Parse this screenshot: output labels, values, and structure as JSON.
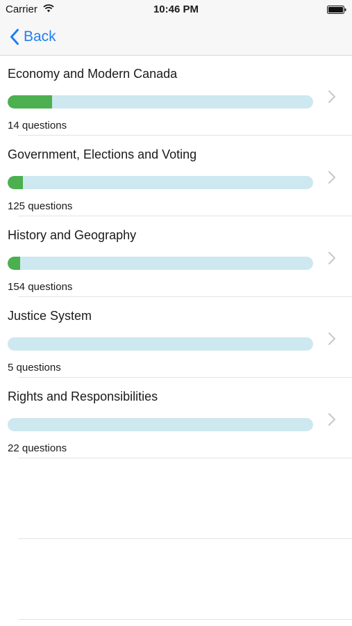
{
  "status_bar": {
    "carrier": "Carrier",
    "time": "10:46 PM",
    "wifi_icon": "wifi-icon",
    "battery_icon": "battery-icon"
  },
  "nav": {
    "back_label": "Back",
    "back_icon": "chevron-left-icon",
    "accent_color": "#1f7ef2"
  },
  "colors": {
    "progress_fill": "#4caf50",
    "progress_track": "#cde8ef",
    "disclosure_chevron": "#c7c7cc"
  },
  "categories": [
    {
      "title": "Economy and Modern Canada",
      "count_label": "14 questions",
      "progress": 0.145,
      "chevron_icon": "chevron-right-icon"
    },
    {
      "title": "Government, Elections and Voting",
      "count_label": "125 questions",
      "progress": 0.05,
      "chevron_icon": "chevron-right-icon"
    },
    {
      "title": "History and Geography",
      "count_label": "154 questions",
      "progress": 0.04,
      "chevron_icon": "chevron-right-icon"
    },
    {
      "title": "Justice System",
      "count_label": "5 questions",
      "progress": 0,
      "chevron_icon": "chevron-right-icon"
    },
    {
      "title": "Rights and Responsibilities",
      "count_label": "22 questions",
      "progress": 0,
      "chevron_icon": "chevron-right-icon"
    }
  ]
}
